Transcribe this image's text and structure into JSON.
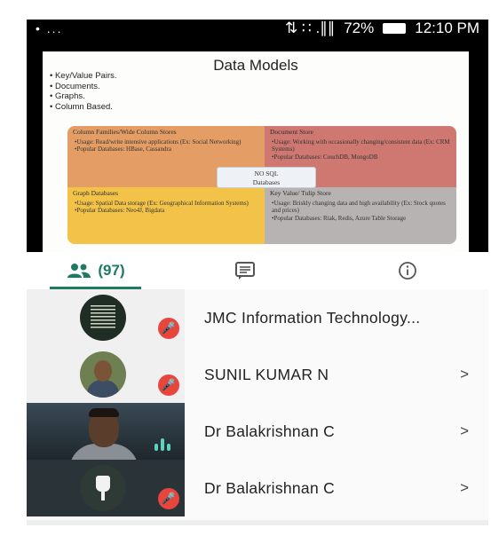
{
  "status_bar": {
    "left": "• ...",
    "signal": "⇅ ∷ .∥∥",
    "battery_percent": "72%",
    "time": "12:10 PM"
  },
  "slide": {
    "title": "Data Models",
    "bullets": [
      "Key/Value Pairs.",
      "Documents.",
      "Graphs.",
      "Column Based."
    ],
    "center_label_line1": "NO SQL",
    "center_label_line2": "Databases",
    "quadrants": [
      {
        "title": "Column Families/Wide Column Stores",
        "items": [
          "Usage: Read/write intensive applications (Ex: Social Networking)",
          "Popular Databases: HBase, Cassandra"
        ]
      },
      {
        "title": "Document Store",
        "items": [
          "Usage: Working with occasionally changing/consistent data (Ex: CRM Systems)",
          "Popular Databases: CouchDB, MongoDB"
        ]
      },
      {
        "title": "Graph Databases",
        "items": [
          "Usage: Spatial Data storage (Ex: Geographical Information Systems)",
          "Popular Databases: Neo4J, Bigdata"
        ]
      },
      {
        "title": "Key Value/ Tulip Store",
        "items": [
          "Usage: Briskly changing data and high availability (Ex: Stock quotes and prices)",
          "Popular Databases: Riak, Redis, Azure Table Storage"
        ]
      }
    ]
  },
  "tabs": {
    "people_count": "(97)",
    "active_color": "#1f7a63"
  },
  "participants": [
    {
      "name": "JMC Information Technology...",
      "muted": true,
      "chevron": ""
    },
    {
      "name": "SUNIL KUMAR N",
      "muted": true,
      "chevron": ">"
    },
    {
      "name": "Dr Balakrishnan C",
      "muted": false,
      "chevron": ">"
    },
    {
      "name": "Dr Balakrishnan C",
      "muted": true,
      "chevron": ">"
    }
  ],
  "colors": {
    "mute_badge": "#e8453c",
    "speaking_bars": "#5fd3c1"
  }
}
